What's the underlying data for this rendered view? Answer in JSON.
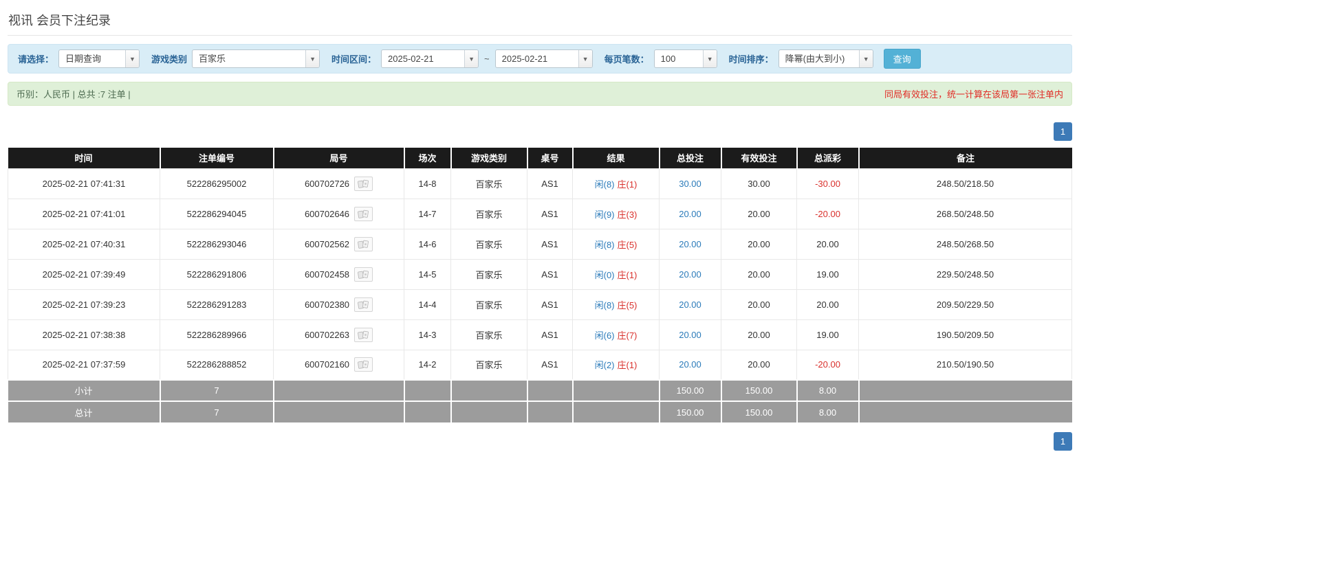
{
  "page": {
    "title": "视讯 会员下注纪录"
  },
  "filter": {
    "select_label": "请选择：",
    "select_value": "日期查询",
    "game_label": "游戏类别",
    "game_value": "百家乐",
    "range_label": "时间区间：",
    "date_from": "2025-02-21",
    "range_separator": "~",
    "date_to": "2025-02-21",
    "page_size_label": "每页笔数：",
    "page_size_value": "100",
    "sort_label": "时间排序：",
    "sort_value": "降幂(由大到小)",
    "search_label": "查询"
  },
  "summary": {
    "currency_info": "币别：人民币 | 总共 :7 注单 |",
    "notice": "同局有效投注，统一计算在该局第一张注单内"
  },
  "pagination": {
    "current_page": "1"
  },
  "table": {
    "headers": [
      "时间",
      "注单编号",
      "局号",
      "场次",
      "游戏类别",
      "桌号",
      "结果",
      "总投注",
      "有效投注",
      "总派彩",
      "备注"
    ],
    "rows": [
      {
        "time": "2025-02-21 07:41:31",
        "bet_id": "522286295002",
        "round_no": "600702726",
        "session": "14-8",
        "game": "百家乐",
        "table_no": "AS1",
        "result": {
          "player": "闲(8)",
          "banker": "庄(1)"
        },
        "total_bet": "30.00",
        "valid_bet": "30.00",
        "payout": "-30.00",
        "remark": "248.50/218.50"
      },
      {
        "time": "2025-02-21 07:41:01",
        "bet_id": "522286294045",
        "round_no": "600702646",
        "session": "14-7",
        "game": "百家乐",
        "table_no": "AS1",
        "result": {
          "player": "闲(9)",
          "banker": "庄(3)"
        },
        "total_bet": "20.00",
        "valid_bet": "20.00",
        "payout": "-20.00",
        "remark": "268.50/248.50"
      },
      {
        "time": "2025-02-21 07:40:31",
        "bet_id": "522286293046",
        "round_no": "600702562",
        "session": "14-6",
        "game": "百家乐",
        "table_no": "AS1",
        "result": {
          "player": "闲(8)",
          "banker": "庄(5)"
        },
        "total_bet": "20.00",
        "valid_bet": "20.00",
        "payout": "20.00",
        "remark": "248.50/268.50"
      },
      {
        "time": "2025-02-21 07:39:49",
        "bet_id": "522286291806",
        "round_no": "600702458",
        "session": "14-5",
        "game": "百家乐",
        "table_no": "AS1",
        "result": {
          "player": "闲(0)",
          "banker": "庄(1)"
        },
        "total_bet": "20.00",
        "valid_bet": "20.00",
        "payout": "19.00",
        "remark": "229.50/248.50"
      },
      {
        "time": "2025-02-21 07:39:23",
        "bet_id": "522286291283",
        "round_no": "600702380",
        "session": "14-4",
        "game": "百家乐",
        "table_no": "AS1",
        "result": {
          "player": "闲(8)",
          "banker": "庄(5)"
        },
        "total_bet": "20.00",
        "valid_bet": "20.00",
        "payout": "20.00",
        "remark": "209.50/229.50"
      },
      {
        "time": "2025-02-21 07:38:38",
        "bet_id": "522286289966",
        "round_no": "600702263",
        "session": "14-3",
        "game": "百家乐",
        "table_no": "AS1",
        "result": {
          "player": "闲(6)",
          "banker": "庄(7)"
        },
        "total_bet": "20.00",
        "valid_bet": "20.00",
        "payout": "19.00",
        "remark": "190.50/209.50"
      },
      {
        "time": "2025-02-21 07:37:59",
        "bet_id": "522286288852",
        "round_no": "600702160",
        "session": "14-2",
        "game": "百家乐",
        "table_no": "AS1",
        "result": {
          "player": "闲(2)",
          "banker": "庄(1)"
        },
        "total_bet": "20.00",
        "valid_bet": "20.00",
        "payout": "-20.00",
        "remark": "210.50/190.50"
      }
    ],
    "subtotal": {
      "label": "小计",
      "count": "7",
      "total_bet": "150.00",
      "valid_bet": "150.00",
      "payout": "8.00"
    },
    "total": {
      "label": "总计",
      "count": "7",
      "total_bet": "150.00",
      "valid_bet": "150.00",
      "payout": "8.00"
    }
  },
  "colors": {
    "accent_blue": "#2a7ab9",
    "negative_red": "#d9302c",
    "header_bg": "#1b1b1b",
    "footer_bg": "#9c9c9c",
    "filter_bg": "#d9edf7",
    "summary_bg": "#dff0d8",
    "search_button_bg": "#53b1d6",
    "pagination_bg": "#3d7ab7"
  },
  "icons": {
    "combo_arrow": "▼",
    "round_preview": "cards-icon"
  }
}
